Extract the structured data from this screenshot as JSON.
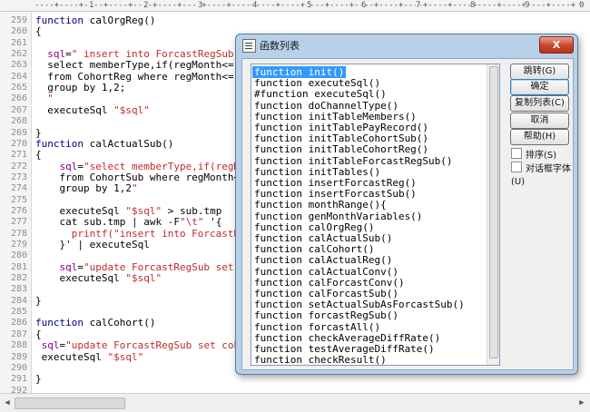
{
  "ruler": {
    "marks": [
      "1",
      "2",
      "3",
      "4",
      "5",
      "6",
      "7",
      "8",
      "9",
      "0"
    ]
  },
  "editor": {
    "lines": [
      {
        "n": "259",
        "parts": [
          [
            "kw",
            "function "
          ],
          [
            "pl",
            "calOrgReg()"
          ]
        ]
      },
      {
        "n": "260",
        "parts": [
          [
            "pl",
            "{"
          ]
        ]
      },
      {
        "n": "261",
        "parts": []
      },
      {
        "n": "262",
        "parts": [
          [
            "prp",
            "  sql"
          ],
          [
            "pl",
            "="
          ],
          [
            "str",
            "\" insert into ForcastRegSub(me"
          ]
        ]
      },
      {
        "n": "263",
        "parts": [
          [
            "pl",
            "  select memberType,if(regMonth<='$t"
          ]
        ]
      },
      {
        "n": "264",
        "parts": [
          [
            "pl",
            "  from CohortReg where regMonth<='$t"
          ]
        ]
      },
      {
        "n": "265",
        "parts": [
          [
            "pl",
            "  group by 1,2;"
          ]
        ]
      },
      {
        "n": "266",
        "parts": [
          [
            "str",
            "  \""
          ]
        ]
      },
      {
        "n": "267",
        "parts": [
          [
            "pl",
            "  executeSql "
          ],
          [
            "str",
            "\"$sql\""
          ]
        ]
      },
      {
        "n": "268",
        "parts": []
      },
      {
        "n": "269",
        "parts": [
          [
            "pl",
            "}"
          ]
        ]
      },
      {
        "n": "270",
        "parts": [
          [
            "kw",
            "function "
          ],
          [
            "pl",
            "calActualSub()"
          ]
        ]
      },
      {
        "n": "271",
        "parts": [
          [
            "pl",
            "{"
          ]
        ]
      },
      {
        "n": "272",
        "parts": [
          [
            "prp",
            "    sql"
          ],
          [
            "pl",
            "="
          ],
          [
            "str",
            "\"select memberType,if(regMon"
          ]
        ]
      },
      {
        "n": "273",
        "parts": [
          [
            "pl",
            "    from CohortSub where regMonth<='"
          ]
        ]
      },
      {
        "n": "274",
        "parts": [
          [
            "pl",
            "    group by 1,2"
          ],
          [
            "str",
            "\""
          ]
        ]
      },
      {
        "n": "275",
        "parts": []
      },
      {
        "n": "276",
        "parts": [
          [
            "pl",
            "    executeSql "
          ],
          [
            "str",
            "\"$sql\""
          ],
          [
            "pl",
            " > sub.tmp"
          ]
        ]
      },
      {
        "n": "277",
        "parts": [
          [
            "pl",
            "    cat sub.tmp | awk -F"
          ],
          [
            "str",
            "\"\\t\""
          ],
          [
            "pl",
            " '{"
          ]
        ]
      },
      {
        "n": "278",
        "parts": [
          [
            "str",
            "      printf(\"insert into ForcastReg"
          ]
        ]
      },
      {
        "n": "279",
        "parts": [
          [
            "pl",
            "    }' | executeSql"
          ]
        ]
      },
      {
        "n": "280",
        "parts": []
      },
      {
        "n": "281",
        "parts": [
          [
            "prp",
            "    sql"
          ],
          [
            "pl",
            "="
          ],
          [
            "str",
            "\"update ForcastRegSub set ac"
          ]
        ]
      },
      {
        "n": "282",
        "parts": [
          [
            "pl",
            "    executeSql "
          ],
          [
            "str",
            "\"$sql\""
          ]
        ]
      },
      {
        "n": "283",
        "parts": []
      },
      {
        "n": "284",
        "parts": [
          [
            "pl",
            "}"
          ]
        ]
      },
      {
        "n": "285",
        "parts": []
      },
      {
        "n": "286",
        "parts": [
          [
            "kw",
            "function "
          ],
          [
            "pl",
            "calCohort()"
          ]
        ]
      },
      {
        "n": "287",
        "parts": [
          [
            "pl",
            "{"
          ]
        ]
      },
      {
        "n": "288",
        "parts": [
          [
            "prp",
            " sql"
          ],
          [
            "pl",
            "="
          ],
          [
            "str",
            "\"update ForcastRegSub set cohor"
          ]
        ]
      },
      {
        "n": "289",
        "parts": [
          [
            "pl",
            " executeSql "
          ],
          [
            "str",
            "\"$sql\""
          ]
        ]
      },
      {
        "n": "290",
        "parts": []
      },
      {
        "n": "291",
        "parts": [
          [
            "pl",
            "}"
          ]
        ]
      },
      {
        "n": "292",
        "parts": []
      }
    ]
  },
  "dialog": {
    "title": "函数列表",
    "close_label": "X",
    "selected_index": 0,
    "functions": [
      "function init()",
      "function executeSql()",
      "#function executeSql()",
      "function doChannelType()",
      "function initTableMembers()",
      "function initTablePayRecord()",
      "function initTableCohortSub()",
      "function initTableCohortReg()",
      "function initTableForcastRegSub()",
      "function initTables()",
      "function insertForcastReg()",
      "function insertForcastSub()",
      "function monthRange(){",
      "function genMonthVariables()",
      "function calOrgReg()",
      "function calActualSub()",
      "function calCohort()",
      "function calActualReg()",
      "function calActualConv()",
      "function calForcastConv()",
      "function calForcastSub()",
      "function setActualSubAsForcastSub()",
      "function forcastRegSub()",
      "function forcastAll()",
      "function checkAverageDiffRate()",
      "function testAverageDiffRate()",
      "function checkResult()"
    ],
    "buttons": {
      "goto": "跳转(G)",
      "ok": "确定",
      "copy": "复制列表(C)",
      "cancel": "取消",
      "help": "帮助(H)"
    },
    "checkboxes": {
      "sort": "排序(S)",
      "dialog_font": "对话框字体(U)"
    }
  }
}
